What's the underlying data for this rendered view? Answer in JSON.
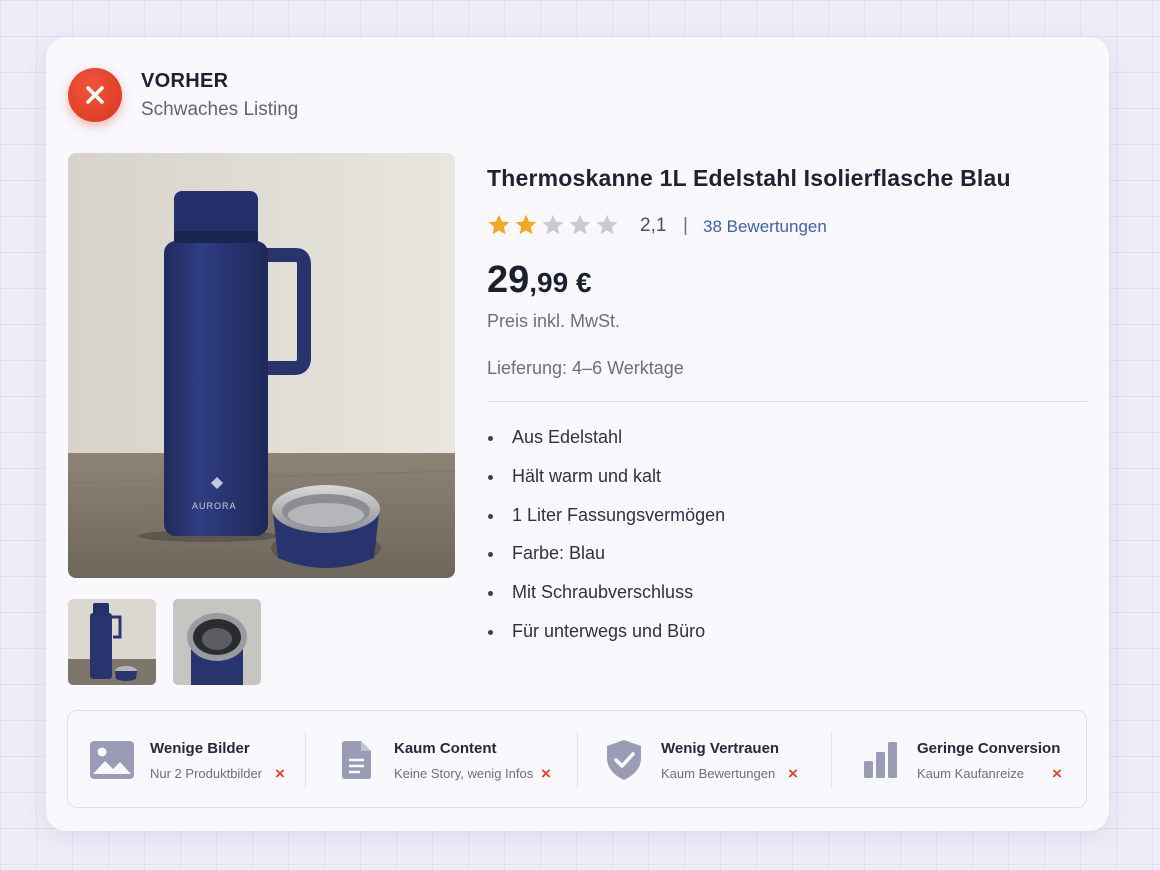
{
  "header": {
    "title": "VORHER",
    "subtitle": "Schwaches Listing"
  },
  "product": {
    "title": "Thermoskanne 1L Edelstahl Isolierflasche Blau",
    "rating_value": "2,1",
    "rating_stars": 2,
    "rating_max": 5,
    "separator": "|",
    "reviews_label": "38 Bewertungen",
    "price_main": "29",
    "price_cents": ",99 €",
    "tax_note": "Preis inkl. MwSt.",
    "delivery": "Lieferung: 4–6 Werktage",
    "brand_on_bottle": "AURORA",
    "bullets": [
      "Aus Edelstahl",
      "Hält warm und kalt",
      "1 Liter Fassungsvermögen",
      "Farbe: Blau",
      "Mit Schraubverschluss",
      "Für unterwegs und Büro"
    ]
  },
  "features": [
    {
      "title": "Wenige Bilder",
      "sub": "Nur 2 Produktbilder",
      "icon": "image-icon",
      "mark": "×"
    },
    {
      "title": "Kaum Content",
      "sub": "Keine Story, wenig Infos",
      "icon": "document-icon",
      "mark": "×"
    },
    {
      "title": "Wenig Vertrauen",
      "sub": "Kaum Bewertungen",
      "icon": "shield-check-icon",
      "mark": "×"
    },
    {
      "title": "Geringe Conversion",
      "sub": "Kaum Kaufanreize",
      "icon": "bar-chart-icon",
      "mark": "×"
    }
  ],
  "colors": {
    "accent_red": "#e0442d",
    "star_filled": "#f5a623",
    "star_empty": "#c9cad6",
    "link_blue": "#3f5fae",
    "bottle_blue": "#27346e"
  }
}
